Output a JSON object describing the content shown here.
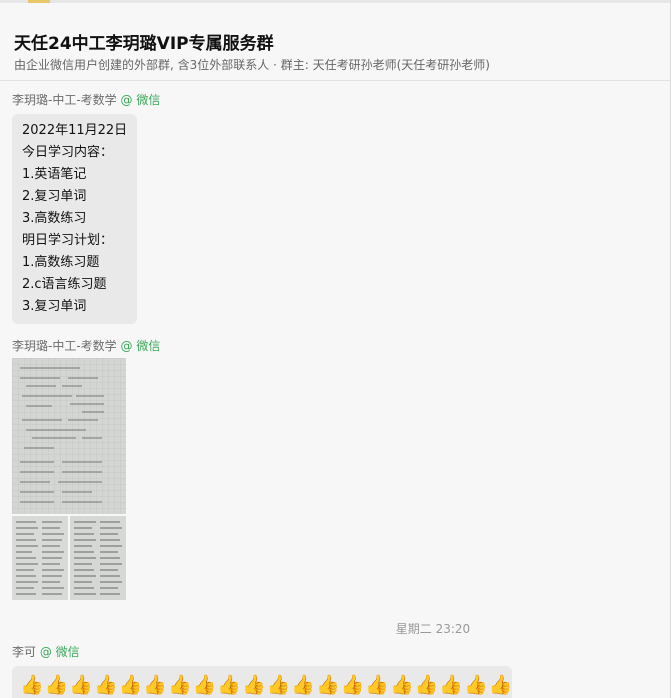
{
  "group": {
    "title": "天任24中工李玥璐VIP专属服务群",
    "subtitle": "由企业微信用户创建的外部群, 含3位外部联系人 · 群主: 天任考研孙老师(天任考研孙老师)"
  },
  "messages": [
    {
      "sender": "李玥璐-中工-考数学",
      "source": "@ 微信",
      "lines": [
        "2022年11月22日",
        "今日学习内容：",
        "1.英语笔记",
        "2.复习单词",
        "3.高数练习",
        "明日学习计划：",
        "1.高数练习题",
        "2.c语言练习题",
        "3.复习单词"
      ]
    },
    {
      "sender": "李玥璐-中工-考数学",
      "source": "@ 微信",
      "images": [
        "handwritten-notes-photo",
        "notebook-page-photo-left",
        "notebook-page-photo-right"
      ]
    }
  ],
  "timestamp": "星期二 23:20",
  "last_message": {
    "sender": "李可",
    "source": "@ 微信",
    "emoji": "thumbs-up-icon",
    "emoji_count": 20
  },
  "colors": {
    "background": "#f7f7f7",
    "bubble": "#e9e9e9",
    "wechat_green": "#3aa95a",
    "thumb": "#e8a21d"
  }
}
